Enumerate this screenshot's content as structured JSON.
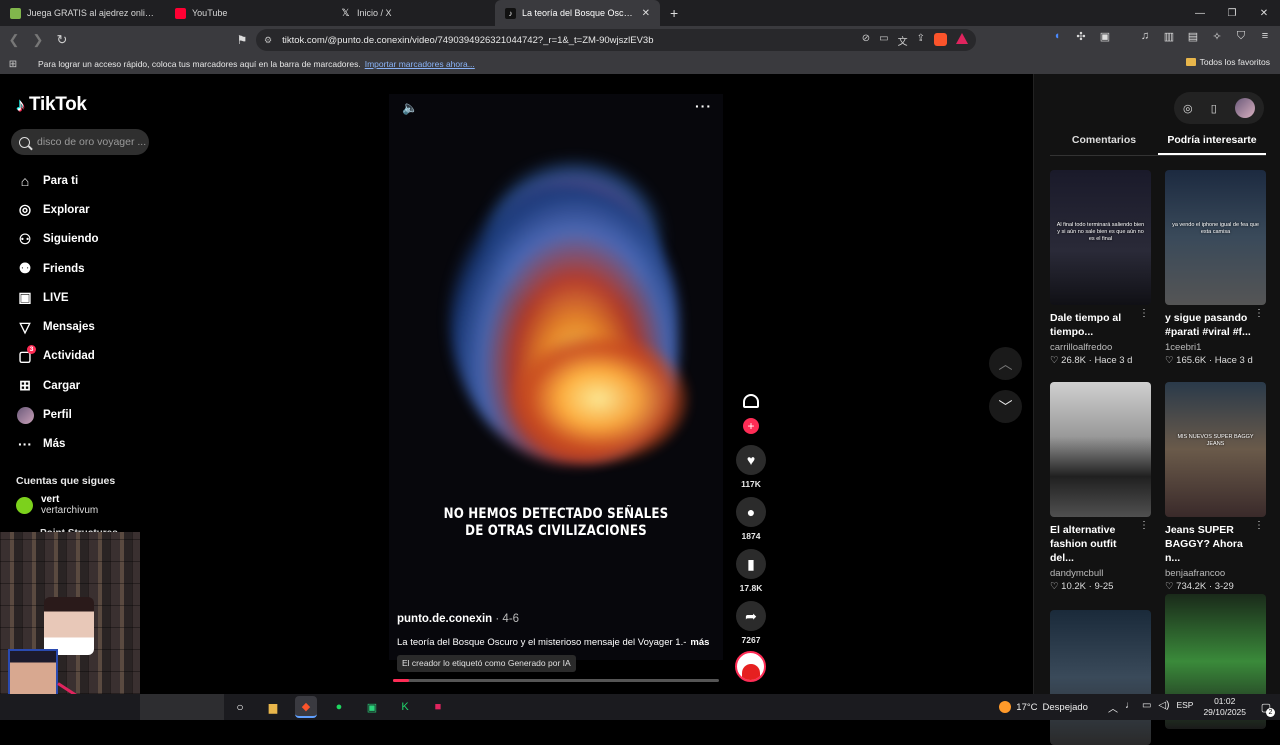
{
  "browser": {
    "tabs": [
      {
        "title": "Juega GRATIS al ajedrez online - Ajed",
        "favicon_color": "#81b64c",
        "active": false
      },
      {
        "title": "YouTube",
        "favicon_color": "#ff0033",
        "active": false
      },
      {
        "title": "Inicio / X",
        "favicon_color": "#000000",
        "active": false
      },
      {
        "title": "La teoría del Bosque Oscuro y su m",
        "favicon_color": "#000000",
        "active": true
      }
    ],
    "new_tab_label": "+",
    "url": "tiktok.com/@punto.de.conexin/video/7490394926321044742?_r=1&_t=ZM-90wjszlEV3b",
    "bookmarks_message": "Para lograr un acceso rápido, coloca tus marcadores aquí en la barra de marcadores.",
    "bookmarks_link": "Importar marcadores ahora...",
    "all_favorites": "Todos los favoritos"
  },
  "sidebar": {
    "logo_text": "TikTok",
    "search_placeholder": "disco de oro voyager ...",
    "nav": [
      {
        "label": "Para ti",
        "icon": "home-icon",
        "glyph": "⌂"
      },
      {
        "label": "Explorar",
        "icon": "compass-icon",
        "glyph": "◎"
      },
      {
        "label": "Siguiendo",
        "icon": "following-icon",
        "glyph": "⚇"
      },
      {
        "label": "Friends",
        "icon": "friends-icon",
        "glyph": "⚉"
      },
      {
        "label": "LIVE",
        "icon": "live-icon",
        "glyph": "▣"
      },
      {
        "label": "Mensajes",
        "icon": "messages-icon",
        "glyph": "▽"
      },
      {
        "label": "Actividad",
        "icon": "activity-icon",
        "glyph": "▢",
        "badge": "3"
      },
      {
        "label": "Cargar",
        "icon": "upload-icon",
        "glyph": "⊞"
      },
      {
        "label": "Perfil",
        "icon": "profile-icon",
        "glyph": ""
      },
      {
        "label": "Más",
        "icon": "more-icon",
        "glyph": "···"
      }
    ],
    "following_heading": "Cuentas que sigues",
    "following": [
      {
        "name": "vert",
        "handle": "vertarchivum"
      },
      {
        "name": "Point Structures"
      }
    ]
  },
  "video": {
    "caption": "NO HEMOS DETECTADO SEÑALES\nDE OTRAS CIVILIZACIONES",
    "author": "punto.de.conexin",
    "date": " · 4-6",
    "description": "La teoría del Bosque Oscuro y el misterioso mensaje del Voyager 1.-",
    "more": "más",
    "ai_label": "El creador lo etiquetó como Generado por IA",
    "progress": 0.05
  },
  "actions": {
    "likes": "117K",
    "comments": "1874",
    "saves": "17.8K",
    "shares": "7267"
  },
  "right_panel": {
    "tabs": [
      "Comentarios",
      "Podría interesarte"
    ],
    "active_tab": 1,
    "cards": [
      {
        "title": "Dale tiempo al tiempo...",
        "user": "carrilloalfredoo",
        "likes": "26.8K",
        "when": "Hace 3 d",
        "overlay": "Al final todo terminará saliendo bien y si aún no sale bien es que aún no es el final",
        "bg": "linear-gradient(180deg,#1a1a2a 0%,#2a2a38 60%,#101015 100%)"
      },
      {
        "title": "y sigue pasando #parati #viral #f...",
        "user": "1ceebri1",
        "likes": "165.6K",
        "when": "Hace 3 d",
        "overlay": "ya vendo el iphone igual de fea que esta camisa",
        "bg": "linear-gradient(180deg,#1c2a40 0%,#3a4a5a 50%,#555 100%)"
      },
      {
        "title": "El alternative fashion outfit del...",
        "user": "dandymcbull",
        "likes": "10.2K",
        "when": "9-25",
        "overlay": "",
        "bg": "linear-gradient(180deg,#d0d0d0 0%,#9a9a9a 40%,#202020 70%,#505050 100%)"
      },
      {
        "title": "Jeans SUPER BAGGY? Ahora n...",
        "user": "benjaafrancoo",
        "likes": "734.2K",
        "when": "3-29",
        "overlay": "MIS NUEVOS SUPER BAGGY JEANS",
        "bg": "linear-gradient(180deg,#2a3a4a 0%,#6a5a4a 50%,#3a2a2a 100%)"
      },
      {
        "title": "",
        "user": "",
        "likes": "",
        "when": "",
        "overlay": "",
        "bg": "linear-gradient(180deg,#1a2a3a 0%,#3a4a5a 50%,#2a2a2a 100%)"
      },
      {
        "title": "",
        "user": "",
        "likes": "",
        "when": "",
        "overlay": "",
        "bg": "linear-gradient(180deg,#1a2a1a 0%,#3a8a3a 50%,#1a1a1a 100%)"
      }
    ]
  },
  "taskbar": {
    "weather_temp": "17°C",
    "weather_text": "Despejado",
    "lang": "ESP",
    "time": "01:02",
    "date": "29/10/2025",
    "notif_count": "2"
  }
}
